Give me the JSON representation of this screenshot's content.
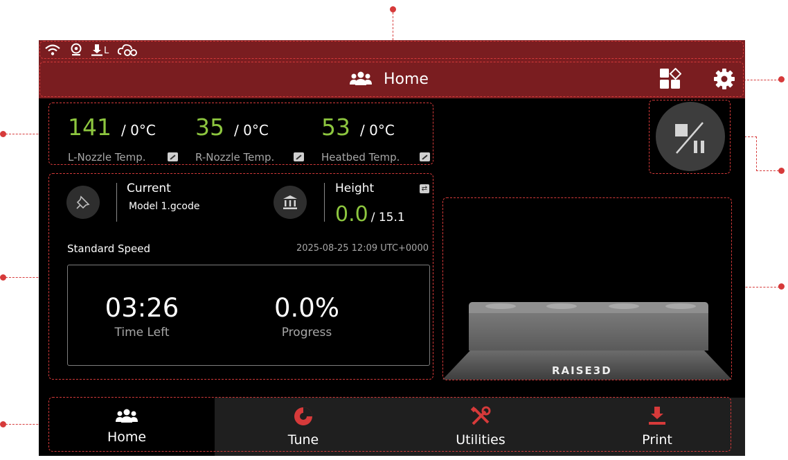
{
  "status_bar": {
    "icons": [
      "wifi-icon",
      "camera-icon",
      "extruder-left-icon",
      "cloud-link-icon"
    ],
    "extruder_letter": "L"
  },
  "header": {
    "icon": "users-icon",
    "title": "Home",
    "actions": [
      "apps-icon",
      "gear-icon"
    ]
  },
  "temperatures": [
    {
      "value": "141",
      "target": "/ 0°C",
      "label": "L-Nozzle Temp."
    },
    {
      "value": "35",
      "target": "/ 0°C",
      "label": "R-Nozzle Temp."
    },
    {
      "value": "53",
      "target": "/ 0°C",
      "label": "Heatbed Temp."
    }
  ],
  "job": {
    "current_label": "Current",
    "file_name": "Model 1.gcode",
    "height_label": "Height",
    "height_value": "0.0",
    "height_total": "/ 15.1",
    "speed_label": "Standard Speed",
    "timestamp": "2025-08-25 12:09 UTC+0000",
    "time_left_value": "03:26",
    "time_left_label": "Time Left",
    "progress_value": "0.0%",
    "progress_label": "Progress"
  },
  "preview": {
    "brand": "RAISE3D"
  },
  "nav": {
    "items": [
      {
        "label": "Home",
        "icon": "users-icon",
        "active": true
      },
      {
        "label": "Tune",
        "icon": "pie-icon",
        "active": false
      },
      {
        "label": "Utilities",
        "icon": "tools-icon",
        "active": false
      },
      {
        "label": "Print",
        "icon": "print-icon",
        "active": false
      }
    ]
  },
  "colors": {
    "accent_red": "#d63a3a",
    "header_red": "#7a1d20",
    "temp_green": "#8dc63f"
  }
}
